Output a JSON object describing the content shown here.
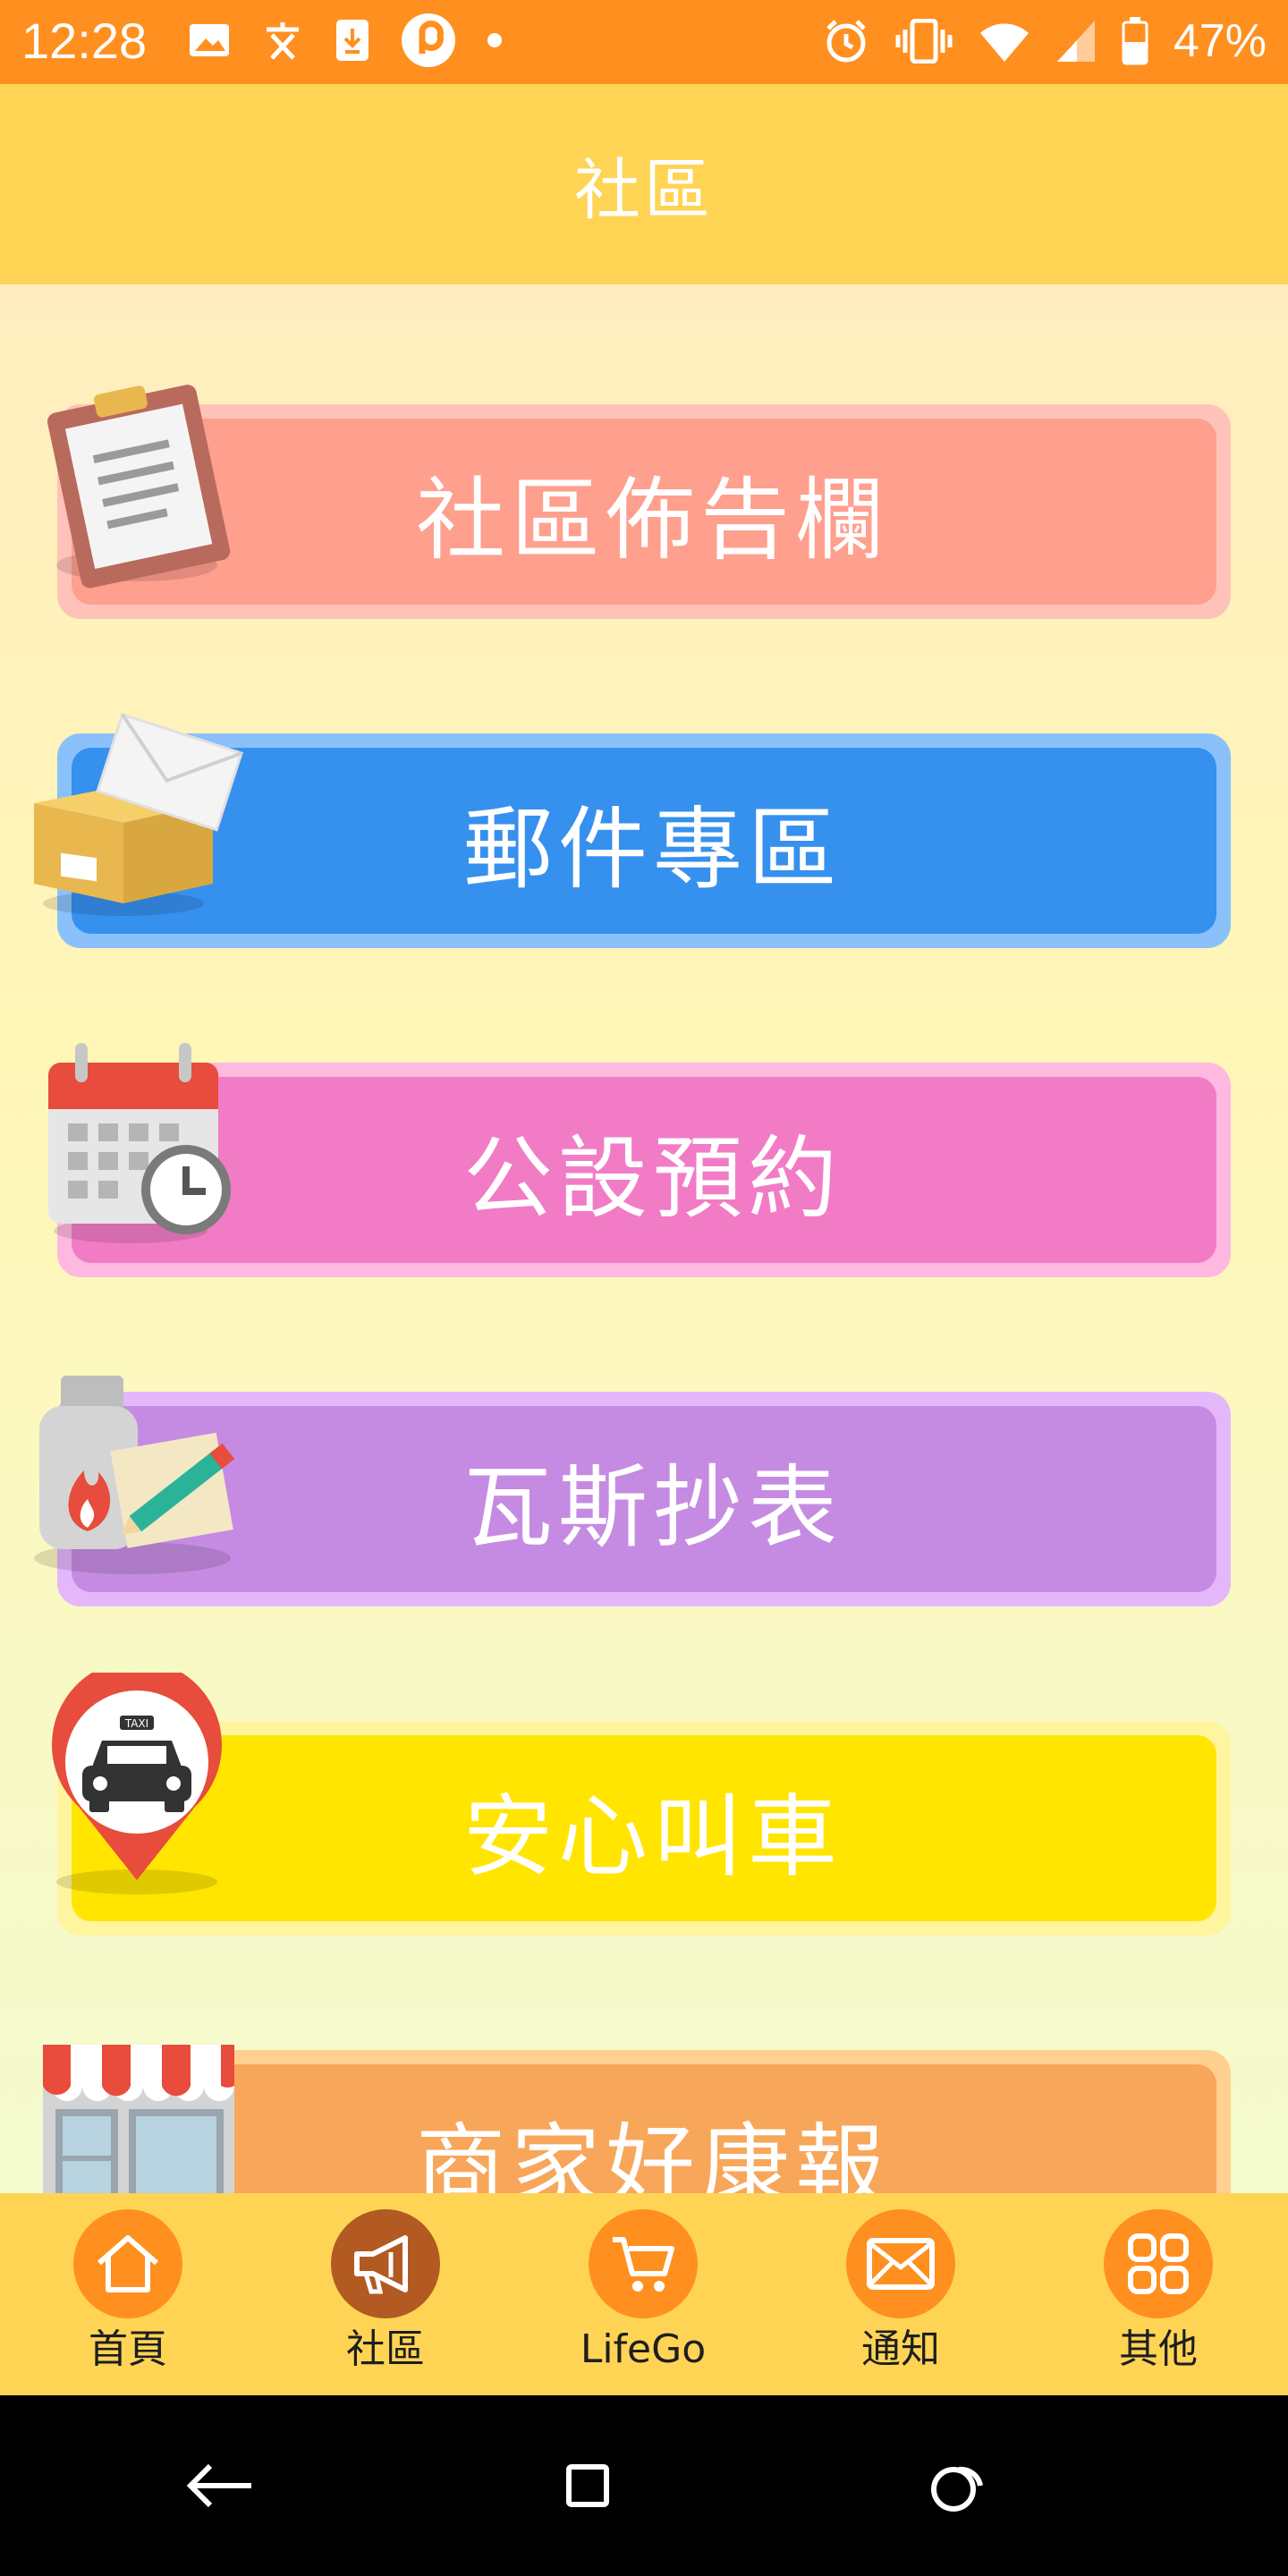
{
  "status_bar": {
    "time": "12:28",
    "left_icons": [
      "image-icon",
      "text-icon",
      "download-icon",
      "p-app-icon",
      "dot-icon"
    ],
    "right_icons": [
      "alarm-icon",
      "vibrate-icon",
      "wifi-icon",
      "signal-icon",
      "battery-icon"
    ],
    "battery": "47%"
  },
  "app_bar": {
    "title": "社區"
  },
  "menu": {
    "items": [
      {
        "label": "社區佈告欄",
        "icon": "clipboard-icon",
        "color": "#FF9F8E",
        "border": "#FFC2B8"
      },
      {
        "label": "郵件專區",
        "icon": "mail-package-icon",
        "color": "#3690EE",
        "border": "#8BC1FA"
      },
      {
        "label": "公設預約",
        "icon": "calendar-clock-icon",
        "color": "#F27BC6",
        "border": "#FFB8E0"
      },
      {
        "label": "瓦斯抄表",
        "icon": "gas-meter-icon",
        "color": "#C58BE2",
        "border": "#E3B7FA"
      },
      {
        "label": "安心叫車",
        "icon": "taxi-pin-icon",
        "color": "#FFE500",
        "border": "#FFF59E"
      },
      {
        "label": "商家好康報",
        "icon": "store-icon",
        "color": "#F8A65A",
        "border": "#FFD08F"
      }
    ]
  },
  "bottom_nav": {
    "items": [
      {
        "label": "首頁",
        "icon": "home-icon",
        "active": false
      },
      {
        "label": "社區",
        "icon": "megaphone-icon",
        "active": true
      },
      {
        "label": "LifeGo",
        "icon": "cart-icon",
        "active": false
      },
      {
        "label": "通知",
        "icon": "envelope-icon",
        "active": false
      },
      {
        "label": "其他",
        "icon": "grid-icon",
        "active": false
      }
    ]
  },
  "system_nav": {
    "icons": [
      "back-icon",
      "recents-icon",
      "assistant-icon"
    ]
  },
  "colors": {
    "status_bar": "#FF8F1F",
    "app_bar": "#FFD455",
    "nav_circle": "#FF8F1F",
    "nav_circle_active": "#B25A22"
  }
}
